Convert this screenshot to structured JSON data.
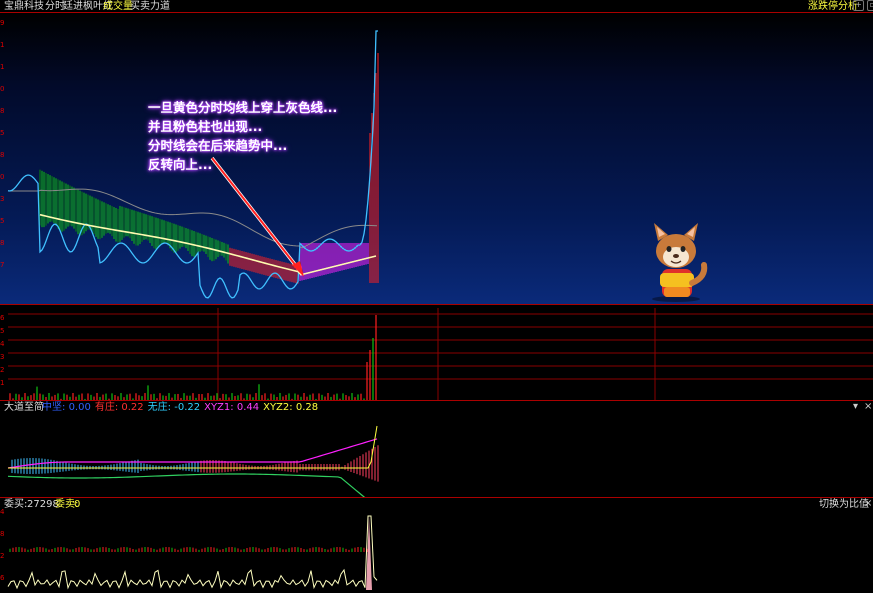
{
  "header": {
    "stock_name": "宝鼎科技",
    "mode": "分时",
    "strategy": "廷进枫叶红",
    "volume_label": "成交量",
    "power_label": "买卖力道",
    "right_label": "涨跌停分析"
  },
  "annotation": {
    "lines": [
      "一旦黄色分时均线上穿上灰色线...",
      "并且粉色柱也出现...",
      "分时线会在后来趋势中...",
      "反转向上..."
    ]
  },
  "main_axis": [
    "9",
    "1",
    "1",
    "0",
    "8",
    "5",
    "8",
    "0",
    "3",
    "5",
    "8",
    "7"
  ],
  "volume_axis": [
    "6",
    "5",
    "4",
    "3",
    "2",
    "1"
  ],
  "indicator": {
    "name": "大道至简",
    "items": [
      {
        "label": "中坚",
        "value": "0.00",
        "color": "#3060ff"
      },
      {
        "label": "有庄",
        "value": "0.22",
        "color": "#ff3030"
      },
      {
        "label": "无庄",
        "value": "-0.22",
        "color": "#30d0ff"
      },
      {
        "label": "XYZ1",
        "value": "0.44",
        "color": "#ff40ff"
      },
      {
        "label": "XYZ2",
        "value": "0.28",
        "color": "#ffff40"
      }
    ],
    "dropdown_glyph": "▾",
    "close_glyph": "×"
  },
  "orders": {
    "buy_label": "委买:",
    "buy_value": "27298",
    "sell_label": "委卖:",
    "sell_value": "0",
    "switch_label": "切换为比值",
    "close_glyph": "×"
  },
  "orders_axis": [
    "4",
    "8",
    "2",
    "6"
  ],
  "colors": {
    "red": "#ff2020",
    "green": "#10c010",
    "magenta": "#ff20ff",
    "yellow": "#ffff40",
    "cyan": "#40c0ff"
  }
}
